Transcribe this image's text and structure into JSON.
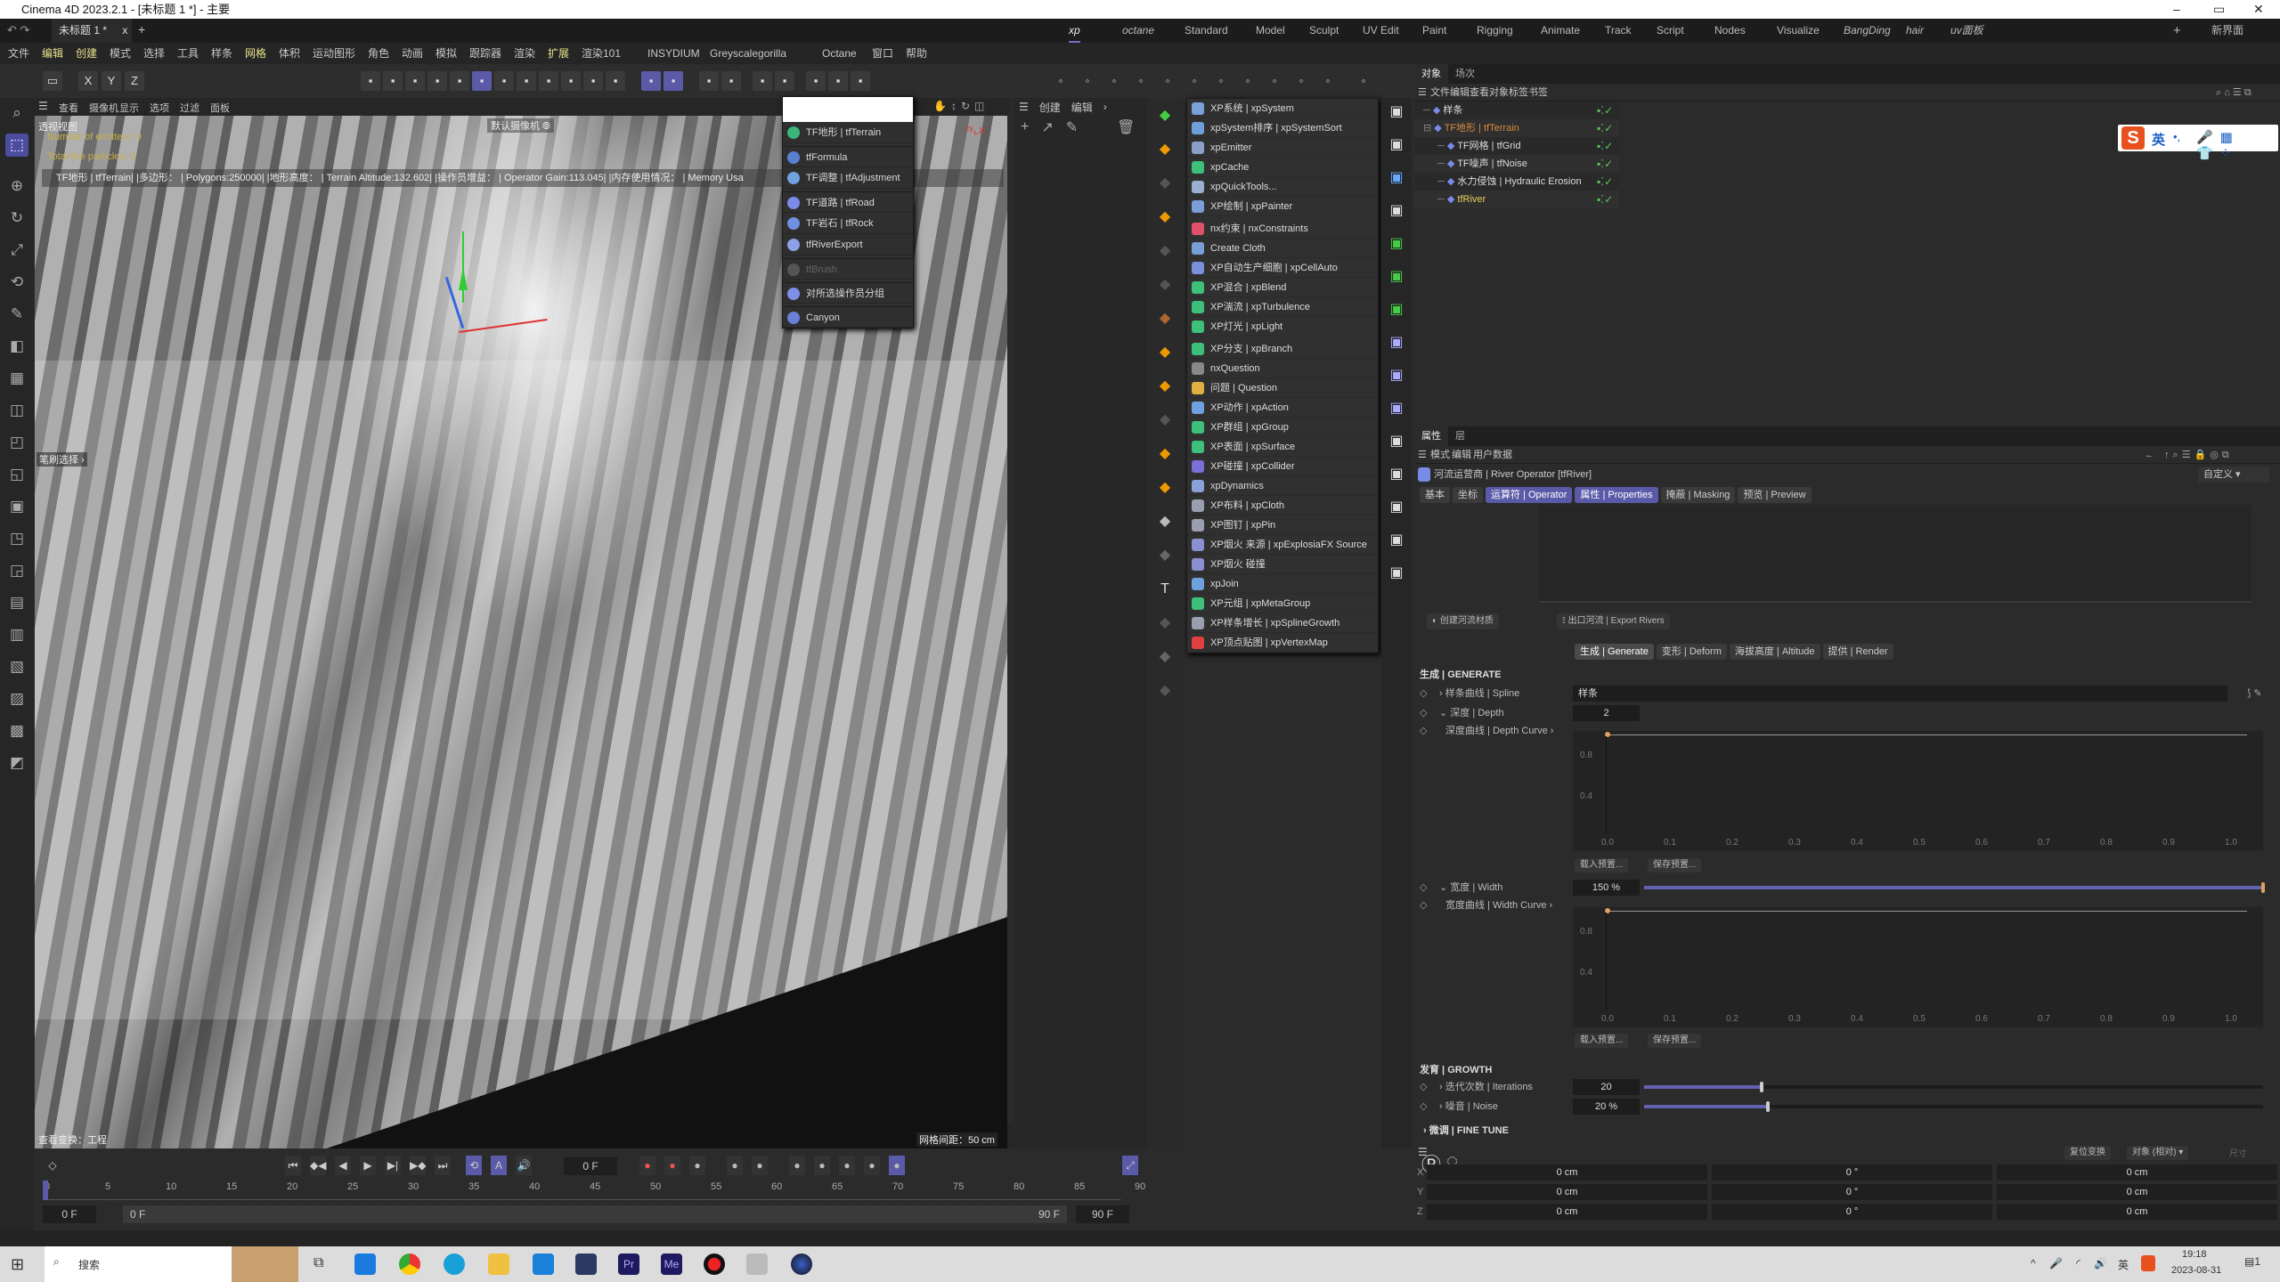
{
  "window": {
    "title": "Cinema 4D 2023.2.1 - [未标题 1 *] - 主要",
    "minimize": "–",
    "maximize": "▭",
    "close": "✕"
  },
  "doc_tab": {
    "label": "未标题 1 *",
    "close": "x",
    "add": "+"
  },
  "layouts": [
    {
      "label": "xp",
      "italic": true,
      "active": true
    },
    {
      "label": "octane",
      "italic": true
    },
    {
      "label": "Standard"
    },
    {
      "label": "Model"
    },
    {
      "label": "Sculpt"
    },
    {
      "label": "UV Edit"
    },
    {
      "label": "Paint"
    },
    {
      "label": "Rigging"
    },
    {
      "label": "Animate"
    },
    {
      "label": "Track"
    },
    {
      "label": "Script"
    },
    {
      "label": "Nodes"
    },
    {
      "label": "Visualize"
    },
    {
      "label": "BangDing",
      "italic": true
    },
    {
      "label": "hair",
      "italic": true
    },
    {
      "label": "uv面板",
      "italic": true
    }
  ],
  "layout_add": "+",
  "new_layout": "新界面",
  "menu": [
    {
      "label": "文件"
    },
    {
      "label": "编辑",
      "hl": true
    },
    {
      "label": "创建",
      "hl": true
    },
    {
      "label": "模式"
    },
    {
      "label": "选择"
    },
    {
      "label": "工具"
    },
    {
      "label": "样条"
    },
    {
      "label": "网格",
      "hl": true
    },
    {
      "label": "体积"
    },
    {
      "label": "运动图形"
    },
    {
      "label": "角色"
    },
    {
      "label": "动画"
    },
    {
      "label": "模拟"
    },
    {
      "label": "跟踪器"
    },
    {
      "label": "渲染"
    },
    {
      "label": "扩展",
      "hl": true
    },
    {
      "label": "渲染101"
    },
    {
      "label": "INSYDIUM"
    },
    {
      "label": "Greyscalegorilla"
    },
    {
      "label": "Octane"
    },
    {
      "label": "窗口"
    },
    {
      "label": "帮助"
    }
  ],
  "toolbar": {
    "axes": [
      "X",
      "Y",
      "Z"
    ]
  },
  "viewport": {
    "menu": [
      "查看",
      "摄像机",
      "显示",
      "选项",
      "过滤",
      "面板"
    ],
    "view_name": "透视视图",
    "emitters": "Number of emitters: 0",
    "particles": "Total live particles: 0",
    "camera": "默认摄像机 ⦾",
    "info": "TF地形 | tfTerrain| |多边形：  | Polygons:250000| |地形高度：  | Terrain Altitude:132.602| |操作员增益：  | Operator Gain:113.045| |内存使用情况：  | Memory Usa",
    "side_label": "笔刷选择 ›",
    "view_transform": "查看变换：工程",
    "grid_spacing": "网格间距：50 cm"
  },
  "tf_menu": {
    "items": [
      {
        "label": "TF地形 | tfTerrain",
        "color": "#3bb57a"
      },
      {
        "label": "tfFormula",
        "color": "#5a7fd0",
        "sep": true
      },
      {
        "label": "TF调整 | tfAdjustment",
        "color": "#6fa0e0"
      },
      {
        "label": "TF道路 | tfRoad",
        "color": "#7a8ae8",
        "sep": true
      },
      {
        "label": "TF岩石 | tfRock",
        "color": "#6f8fe0"
      },
      {
        "label": "tfRiverExport",
        "color": "#8fa0e8"
      },
      {
        "label": "tfBrush",
        "color": "#555",
        "disabled": true,
        "sep": true
      },
      {
        "label": "对所选操作员分组",
        "color": "#7f8fe8",
        "sep": true
      },
      {
        "label": "Canyon",
        "color": "#6a7fd8",
        "sep": true
      }
    ]
  },
  "create_panel": {
    "tabs": [
      "创建",
      "编辑"
    ],
    "more": "›"
  },
  "xp_menu": {
    "items": [
      {
        "label": "XP系统 | xpSystem",
        "color": "#7aa0d8"
      },
      {
        "label": "xpSystem排序 | xpSystemSort",
        "color": "#6f9fd8"
      },
      {
        "label": "xpEmitter",
        "color": "#8aa0c8"
      },
      {
        "label": "xpCache",
        "color": "#3cc07a"
      },
      {
        "label": "xpQuickTools...",
        "color": "#9ab0d0"
      },
      {
        "label": "XP绘制 | xpPainter",
        "color": "#7a9fd8"
      },
      {
        "label": "nx约束 | nxConstraints",
        "color": "#e0506a",
        "sep": true
      },
      {
        "label": "Create Cloth",
        "color": "#7a9fd8"
      },
      {
        "label": "XP自动生产细胞 | xpCellAuto",
        "color": "#7a90d8"
      },
      {
        "label": "XP混合 | xpBlend",
        "color": "#3cc07a"
      },
      {
        "label": "XP湍流 | xpTurbulence",
        "color": "#3cc07a"
      },
      {
        "label": "XP灯光 | xpLight",
        "color": "#3cc07a"
      },
      {
        "label": "XP分支 | xpBranch",
        "color": "#3cc07a",
        "sep": true
      },
      {
        "label": "nxQuestion",
        "color": "#888"
      },
      {
        "label": "问题 | Question",
        "color": "#e0b040"
      },
      {
        "label": "XP动作 | xpAction",
        "color": "#6fa0e0"
      },
      {
        "label": "XP群组 | xpGroup",
        "color": "#3cc07a"
      },
      {
        "label": "XP表面 | xpSurface",
        "color": "#3cc07a"
      },
      {
        "label": "XP碰撞 | xpCollider",
        "color": "#7a70d8"
      },
      {
        "label": "xpDynamics",
        "color": "#8aa0d8"
      },
      {
        "label": "XP布料 | xpCloth",
        "color": "#9aa0b0"
      },
      {
        "label": "XP图钉 | xpPin",
        "color": "#9aa0b0"
      },
      {
        "label": "XP烟火 来源 | xpExplosiaFX Source",
        "color": "#8a90d0"
      },
      {
        "label": "XP烟火 碰撞",
        "color": "#8a90d0"
      },
      {
        "label": "xpJoin",
        "color": "#6fa0e0"
      },
      {
        "label": "XP元组 | xpMetaGroup",
        "color": "#3cc07a"
      },
      {
        "label": "XP样条增长 | xpSplineGrowth",
        "color": "#9aa0b0"
      },
      {
        "label": "XP顶点贴图 | xpVertexMap",
        "color": "#e04040"
      }
    ]
  },
  "object_manager": {
    "tabs": [
      "对象",
      "场次"
    ],
    "menu": [
      "文件",
      "编辑",
      "查看",
      "对象",
      "标签",
      "书签"
    ],
    "objects": [
      {
        "name": "样条",
        "indent": 0,
        "color": "#ddd"
      },
      {
        "name": "TF地形 | tfTerrain",
        "indent": 0,
        "color": "#d88a40",
        "expanded": true
      },
      {
        "name": "TF网格 | tfGrid",
        "indent": 1,
        "color": "#ddd"
      },
      {
        "name": "TF噪声 | tfNoise",
        "indent": 1,
        "color": "#ddd"
      },
      {
        "name": "水力侵蚀 | Hydraulic Erosion",
        "indent": 1,
        "color": "#ddd"
      },
      {
        "name": "tfRiver",
        "indent": 1,
        "color": "#e8d060"
      }
    ]
  },
  "ime": {
    "logo": "S",
    "lang": "英",
    "punct": "•,"
  },
  "attributes": {
    "tabs": [
      "属性",
      "层"
    ],
    "menu": [
      "模式",
      "编辑",
      "用户数据"
    ],
    "object_title": "河流运营商 | River Operator [tfRiver]",
    "preset": "自定义",
    "tabs2": [
      {
        "label": "基本"
      },
      {
        "label": "坐标"
      },
      {
        "label": "运算符 | Operator",
        "on": true
      },
      {
        "label": "属性 | Properties",
        "on": true
      },
      {
        "label": "掩蔽 | Masking"
      },
      {
        "label": "预览 | Preview"
      }
    ],
    "create_material": "创建河流材质",
    "export_rivers": "出口河流 | Export Rivers",
    "subtabs": [
      {
        "label": "生成 | Generate",
        "on": true
      },
      {
        "label": "变形 | Deform"
      },
      {
        "label": "海拔高度 | Altitude"
      },
      {
        "label": "提供 | Render"
      }
    ],
    "generate_title": "生成 | GENERATE",
    "spline_label": "› 样条曲线 | Spline",
    "spline_value": "样条",
    "depth_label": "⌄ 深度 | Depth",
    "depth_value": "2",
    "depth_curve_label": "深度曲线 | Depth Curve ›",
    "width_label": "⌄ 宽度 | Width",
    "width_value": "150 %",
    "width_fraction": 1.0,
    "width_curve_label": "宽度曲线 | Width Curve ›",
    "curve_x_ticks": [
      "0.0",
      "0.1",
      "0.2",
      "0.3",
      "0.4",
      "0.5",
      "0.6",
      "0.7",
      "0.8",
      "0.9",
      "1.0"
    ],
    "curve_y_ticks": [
      "0.8",
      "0.4"
    ],
    "load_preset": "载入预置...",
    "save_preset": "保存预置...",
    "growth_title": "发育 | GROWTH",
    "iterations_label": "› 迭代次数 | Iterations",
    "iterations_value": "20",
    "iterations_fraction": 0.19,
    "noise_label": "› 噪音 | Noise",
    "noise_value": "20 %",
    "noise_fraction": 0.2,
    "finetune_title": "› 微调 | FINE TUNE"
  },
  "coordinates": {
    "reset": "复位变换",
    "mode": "对象 (相对)",
    "size": "尺寸",
    "rows": [
      {
        "axis": "X",
        "pos": "0 cm",
        "rot": "0 °",
        "scale": "0 cm"
      },
      {
        "axis": "Y",
        "pos": "0 cm",
        "rot": "0 °",
        "scale": "0 cm"
      },
      {
        "axis": "Z",
        "pos": "0 cm",
        "rot": "0 °",
        "scale": "0 cm"
      }
    ]
  },
  "timeline": {
    "current": "0 F",
    "start": "0 F",
    "range_start": "0 F",
    "range_end": "90 F",
    "end": "90 F",
    "ticks": [
      "0",
      "5",
      "10",
      "15",
      "20",
      "25",
      "30",
      "35",
      "40",
      "45",
      "50",
      "55",
      "60",
      "65",
      "70",
      "75",
      "80",
      "85",
      "90"
    ]
  },
  "taskbar": {
    "search": "搜索",
    "time": "19:18",
    "date": "2023-08-31",
    "ime": "英",
    "notif": "1"
  },
  "colors": {
    "accent": "#5a5aa8",
    "terrain_label": "#d88a40",
    "active_object": "#e8d060"
  }
}
